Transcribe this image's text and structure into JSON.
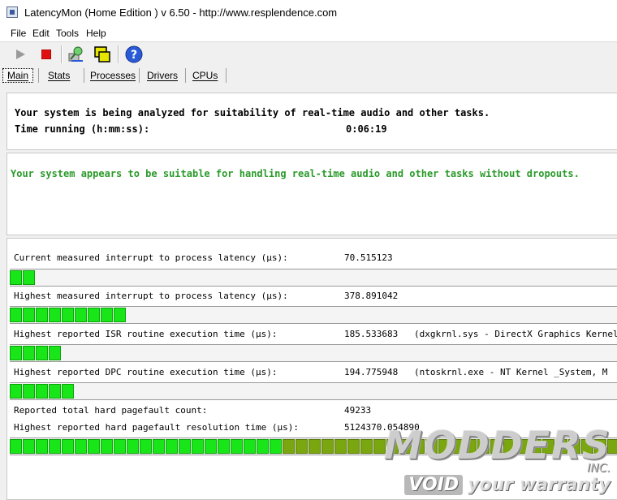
{
  "window": {
    "title": "LatencyMon  (Home Edition )  v 6.50 - http://www.resplendence.com"
  },
  "menu": [
    "File",
    "Edit",
    "Tools",
    "Help"
  ],
  "toolbar": {
    "buttons": [
      {
        "name": "play-icon",
        "color": "#9a9a9a"
      },
      {
        "name": "stop-icon",
        "color": "#e01010"
      },
      {
        "name": "analyze-icon",
        "color": "#2f8a2f"
      },
      {
        "name": "windows-icon",
        "color": "#e6e600"
      },
      {
        "name": "help-icon",
        "color": "#2a5bd7"
      }
    ]
  },
  "tabs": [
    "Main",
    "Stats",
    "Processes",
    "Drivers",
    "CPUs"
  ],
  "status": {
    "line1": "Your system is being analyzed for suitability of real-time audio and other tasks.",
    "time_label": "Time running (h:mm:ss):",
    "time_value": "0:06:19"
  },
  "verdict": {
    "text": "Your system appears to be suitable for handling real-time audio and other tasks without dropouts.",
    "color": "#2a9a2a"
  },
  "metrics": {
    "current_latency": {
      "label": "Current measured interrupt to process latency (µs):",
      "value": "70.515123",
      "segments": 2,
      "max": 47
    },
    "highest_latency": {
      "label": "Highest measured interrupt to process latency (µs):",
      "value": "378.891042",
      "segments": 9,
      "max": 47
    },
    "isr": {
      "label": "Highest reported ISR routine execution time (µs):",
      "value": "185.533683",
      "detail": "(dxgkrnl.sys - DirectX Graphics Kernel",
      "segments": 4,
      "max": 47
    },
    "dpc": {
      "label": "Highest reported DPC routine execution time (µs):",
      "value": "194.775948",
      "detail": "(ntoskrnl.exe - NT Kernel _System, M",
      "segments": 5,
      "max": 47
    },
    "pagefault_count": {
      "label": "Reported total hard pagefault count:",
      "value": "49233"
    },
    "pagefault_time": {
      "label": "Highest reported hard pagefault resolution time (µs):",
      "value": "5124370.054890",
      "segments": 47,
      "max": 47
    }
  },
  "watermark": {
    "brand": "MODDERS",
    "suffix": "INC.",
    "void": "VOID",
    "tagline": "your warranty"
  }
}
